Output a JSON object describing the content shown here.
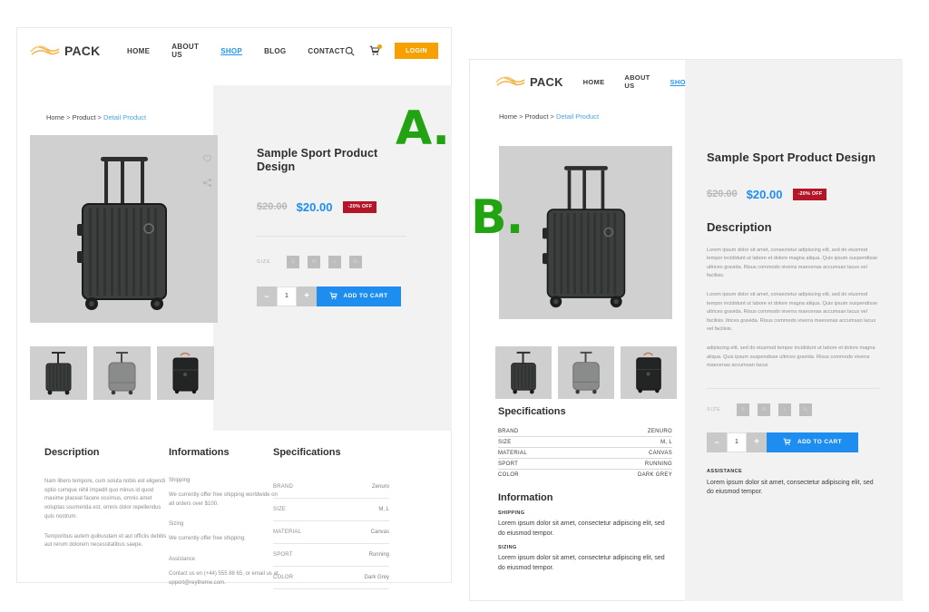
{
  "brand": {
    "name": "PACK",
    "logo_icon": "ribbon-swoosh-logo"
  },
  "nav": {
    "items": [
      {
        "label": "HOME",
        "active": false
      },
      {
        "label": "ABOUT US",
        "active": false
      },
      {
        "label": "SHOP",
        "active": true
      },
      {
        "label": "BLOG",
        "active": false
      },
      {
        "label": "CONTACT",
        "active": false
      }
    ],
    "search_icon": "search-icon",
    "cart_icon": "cart-icon",
    "cart_count": "0",
    "login_label": "LOGIN"
  },
  "breadcrumb": {
    "home": "Home",
    "sep1": ">",
    "product": "Product",
    "sep2": ">",
    "current": "Detail Product"
  },
  "product": {
    "title": "Sample Sport Product Design",
    "price_old": "$20.00",
    "price_new": "$20.00",
    "discount_badge": "-20% OFF",
    "size_label": "SIZE",
    "sizes": [
      "S",
      "M",
      "L",
      "XL"
    ],
    "qty": "1",
    "qty_minus": "−",
    "qty_plus": "+",
    "add_to_cart": "ADD TO CART",
    "wishlist_icon": "heart-icon",
    "share_icon": "share-icon",
    "main_image_alt": "dark-grey-ribbed-suitcase",
    "thumbnails": [
      {
        "alt": "suitcase-thumb-dark-ribbed"
      },
      {
        "alt": "suitcase-thumb-grey-soft"
      },
      {
        "alt": "suitcase-thumb-black-fabric"
      }
    ]
  },
  "panel_a": {
    "marker": "A.",
    "description": {
      "heading": "Description",
      "p1": "Nam libero tempore, cum soluta nobis est eligendi optio cumque nihil impedit quo minus id quod maxime placeat facere ossimus, omnis amet voluptas ssumenda est, omnis dolor repellendus quis nostrum.",
      "p2": "Temporibus autem quibusdam et aut officiis debitis aut rerum dolorem necessitatibus saepe."
    },
    "informations": {
      "heading": "Informations",
      "items": [
        {
          "label": "Shipping",
          "text": "We currently offer free shipping worldwide on all orders over $100."
        },
        {
          "label": "Sizing",
          "text": "We currently offer free shipping."
        },
        {
          "label": "Assistance",
          "text": "Contact us en (+44) 555 88 65, or email us at upport@reytheme.com."
        }
      ]
    },
    "specifications": {
      "heading": "Specifications",
      "rows": [
        {
          "key": "BRAND",
          "value": "Zenuro"
        },
        {
          "key": "SIZE",
          "value": "M, L"
        },
        {
          "key": "MATERIAL",
          "value": "Canvas"
        },
        {
          "key": "SPORT",
          "value": "Running"
        },
        {
          "key": "COLOR",
          "value": "Dark Grey"
        }
      ]
    }
  },
  "panel_b": {
    "marker": "B.",
    "description": {
      "heading": "Description",
      "p1": "Lorem ipsum dolor sit amet, consectetur adipiscing elit, sed do eiusmod tempor incididunt ut labore et dolore magna aliqua. Quis ipsum suspendisse ultrices gravida. Risus commodo viverra maecenas accumsan lacus vel facilisis.",
      "p2": "Lorem ipsum dolor sit amet, consectetur adipiscing elit, sed do eiusmod tempor incididunt ut labore et dolore magna aliqua. Quis ipsum suspendisse ultrices gravida. Risus commodo viverra maecenas accumsan lacus vel facilisis. ltrices gravida. Risus commodo viverra maecenas accumsan lacus vel facilisis.",
      "p3": "adipiscing elit, sed do eiusmod tempor incididunt ut labore et dolore magna aliqua. Quis ipsum suspendisse ultrices gravida. Risus commodo viverra maecenas accumsan lacus"
    },
    "specifications": {
      "heading": "Specifications",
      "rows": [
        {
          "key": "BRAND",
          "value": "ZENURO"
        },
        {
          "key": "SIZE",
          "value": "M, L"
        },
        {
          "key": "MATERIAL",
          "value": "CANVAS"
        },
        {
          "key": "SPORT",
          "value": "RUNNING"
        },
        {
          "key": "COLOR",
          "value": "DARK GREY"
        }
      ]
    },
    "information": {
      "heading": "Information",
      "items": [
        {
          "label": "SHIPPING",
          "text": "Lorem ipsum dolor sit amet, consectetur adipiscing elit, sed do eiusmod tempor."
        },
        {
          "label": "SIZING",
          "text": "Lorem ipsum dolor sit amet, consectetur adipiscing elit, sed do eiusmod tempor."
        }
      ]
    },
    "assistance": {
      "label": "ASSISTANCE",
      "text": "Lorem ipsum dolor sit amet, consectetur adipiscing elit, sed do eiusmod tempor."
    }
  },
  "colors": {
    "accent_blue": "#1d8ef0",
    "orange": "#f7a100",
    "badge_red": "#b41527",
    "marker_green": "#22a312",
    "grey_panel": "#f2f2f2",
    "image_grey": "#d0d0d0"
  }
}
